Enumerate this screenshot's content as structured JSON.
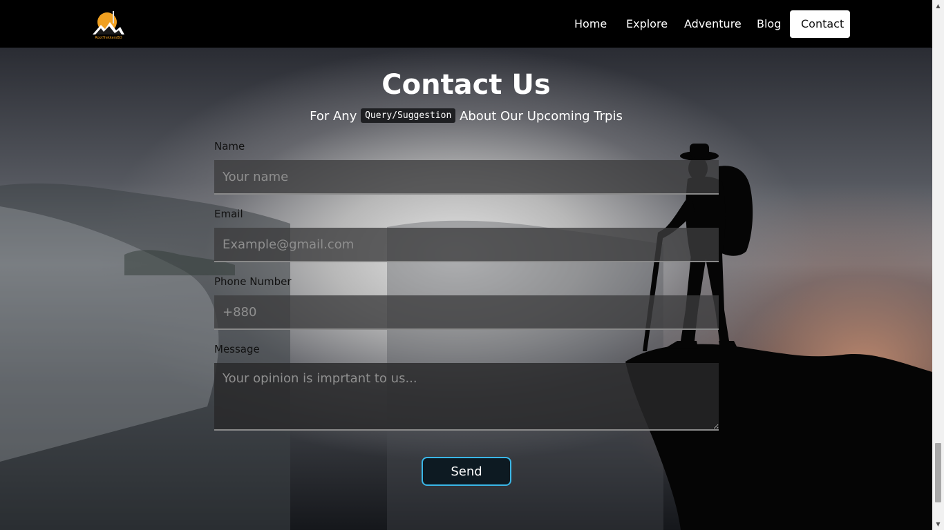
{
  "brand": {
    "logo_text": "RootTrekkersBD"
  },
  "nav": {
    "items": [
      {
        "label": "Home"
      },
      {
        "label": "Explore"
      },
      {
        "label": "Adventure"
      },
      {
        "label": "Blog"
      },
      {
        "label": "Contact",
        "active": true
      }
    ]
  },
  "contact": {
    "title": "Contact Us",
    "subtitle_before": "For Any",
    "subtitle_code": "Query/Suggestion",
    "subtitle_after": "About Our Upcoming Trpis",
    "fields": {
      "name": {
        "label": "Name",
        "placeholder": "Your name"
      },
      "email": {
        "label": "Email",
        "placeholder": "Example@gmail.com"
      },
      "phone": {
        "label": "Phone Number",
        "placeholder": "+880"
      },
      "message": {
        "label": "Message",
        "placeholder": "Your opinion is imprtant to us..."
      }
    },
    "send_label": "Send"
  },
  "colors": {
    "nav_bg": "#000000",
    "button_border": "#3ab7e8",
    "logo_sun": "#f0a020"
  }
}
